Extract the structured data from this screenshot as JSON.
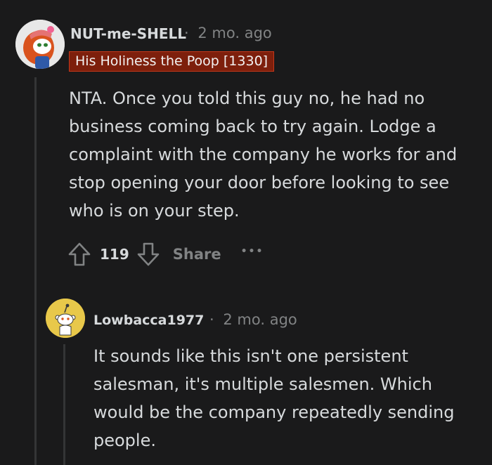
{
  "comment1": {
    "username": "NUT-me-SHELL",
    "separator": "·",
    "timestamp": "2 mo. ago",
    "flair": "His Holiness the Poop [1330]",
    "body": "NTA. Once you told this guy no, he had no business coming back to try again. Lodge a complaint with the company he works for and stop opening your door before looking to see who is on your step.",
    "score": "119",
    "share_label": "Share",
    "more_label": "•••",
    "avatar_icon": "redhead-snoo-avatar-icon"
  },
  "comment2": {
    "username": "Lowbacca1977",
    "separator": "·",
    "timestamp": "2 mo. ago",
    "body": "It sounds like this isn't one persistent salesman, it's multiple salesmen. Which would be the company repeatedly sending people.",
    "avatar_icon": "yellow-snoo-avatar-icon"
  },
  "colors": {
    "background": "#1a1a1b",
    "text": "#d7dadc",
    "muted": "#818384",
    "flair_bg": "#7d1f0c",
    "thread_line": "#343536",
    "avatar2_bg": "#e8c84a"
  }
}
